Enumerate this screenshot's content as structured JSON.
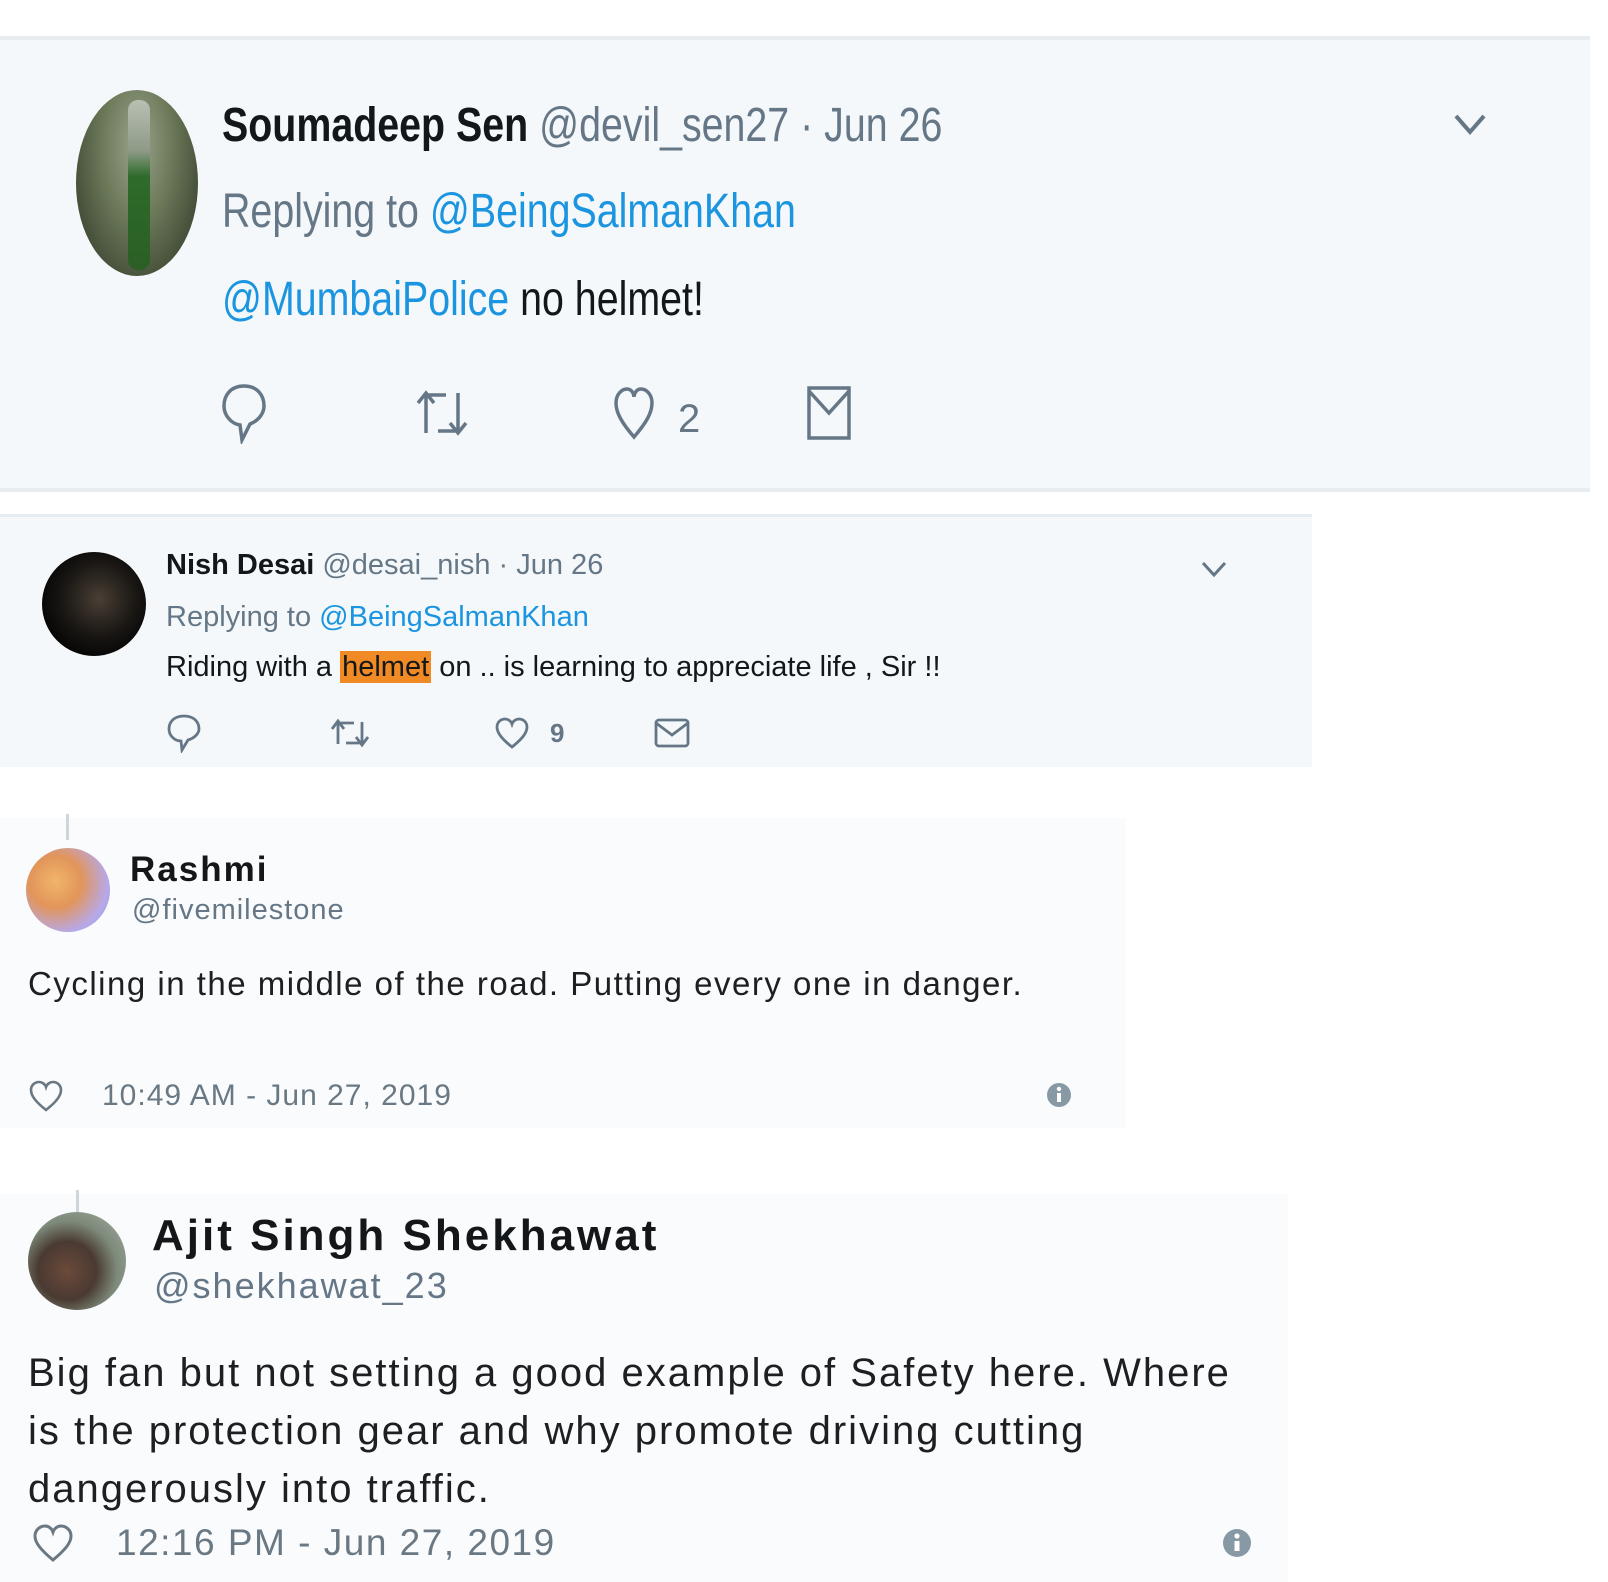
{
  "tweets": [
    {
      "name": "Soumadeep Sen",
      "handle": "@devil_sen27",
      "date": "· Jun 26",
      "replying_label": "Replying to",
      "replying_to": "@BeingSalmanKhan",
      "mention": "@MumbaiPolice",
      "text": " no helmet!",
      "like_count": "2",
      "icons": [
        "reply-icon",
        "retweet-icon",
        "like-icon",
        "direct-message-icon",
        "chevron-down-icon"
      ]
    },
    {
      "name": "Nish Desai",
      "handle": "@desai_nish",
      "date": "· Jun 26",
      "replying_label": "Replying to",
      "replying_to": "@BeingSalmanKhan",
      "text_before": "Riding with a ",
      "text_highlight": "helmet",
      "text_after": " on .. is learning to appreciate life , Sir !!",
      "highlight_color": "#f08a24",
      "like_count": "9",
      "icons": [
        "reply-icon",
        "retweet-icon",
        "like-icon",
        "direct-message-icon",
        "chevron-down-icon"
      ]
    },
    {
      "name": "Rashmi",
      "handle": "@fivemilestone",
      "text": "Cycling in the middle of the road. Putting every one in danger.",
      "timestamp": "10:49 AM - Jun 27, 2019",
      "icons": [
        "like-icon",
        "info-icon"
      ]
    },
    {
      "name": "Ajit Singh Shekhawat",
      "handle": "@shekhawat_23",
      "text": "Big fan but not setting a good example of Safety here. Where is the protection gear and why promote driving cutting dangerously into traffic.",
      "timestamp": "12:16 PM - Jun 27, 2019",
      "icons": [
        "like-icon",
        "info-icon"
      ]
    }
  ],
  "colors": {
    "link": "#1b95e0",
    "muted": "#657786",
    "card_bg": "#f5f8fa",
    "embed_bg": "#fafbfc"
  }
}
